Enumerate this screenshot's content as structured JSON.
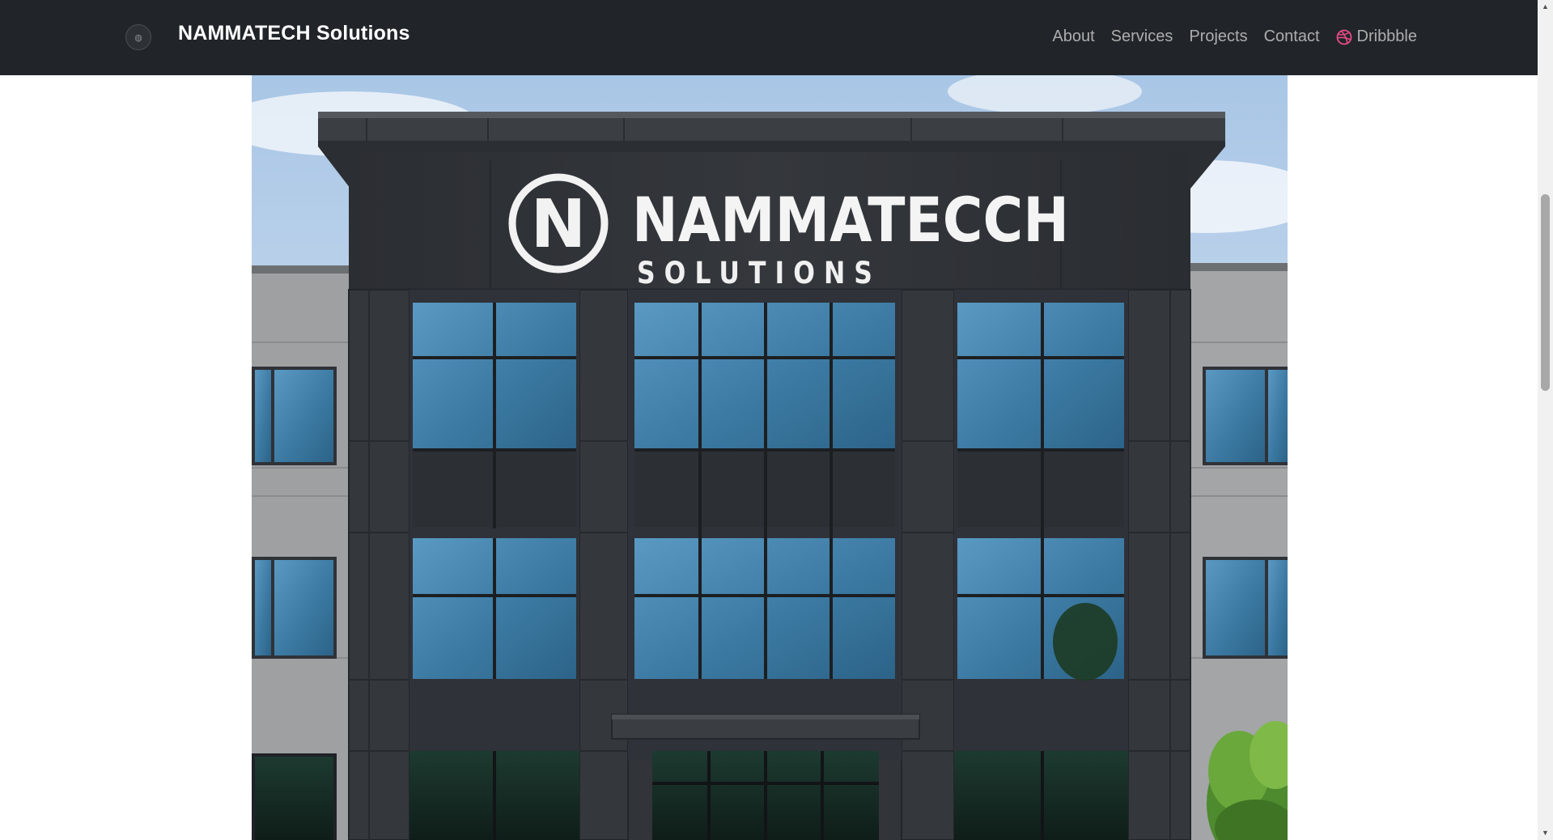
{
  "brand": {
    "name": "NAMMATECH Solutions",
    "logo_icon": "circular-badge-logo"
  },
  "nav": {
    "items": [
      {
        "label": "About"
      },
      {
        "label": "Services"
      },
      {
        "label": "Projects"
      },
      {
        "label": "Contact"
      },
      {
        "label": "Dribbble",
        "icon": "dribbble-icon",
        "icon_color": "#ea4c89"
      }
    ]
  },
  "hero": {
    "sign_title": "NAMMATECCH",
    "sign_subtitle": "SOLUTIONS",
    "sign_monogram": "N"
  },
  "colors": {
    "navbar_bg": "#212529",
    "nav_link": "#a6a8ab",
    "accent_dribbble": "#ea4c89",
    "facade_dark": "#2f3237",
    "glass_blue": "#3f7fa6",
    "cladding_gray": "#9fa1a3"
  }
}
